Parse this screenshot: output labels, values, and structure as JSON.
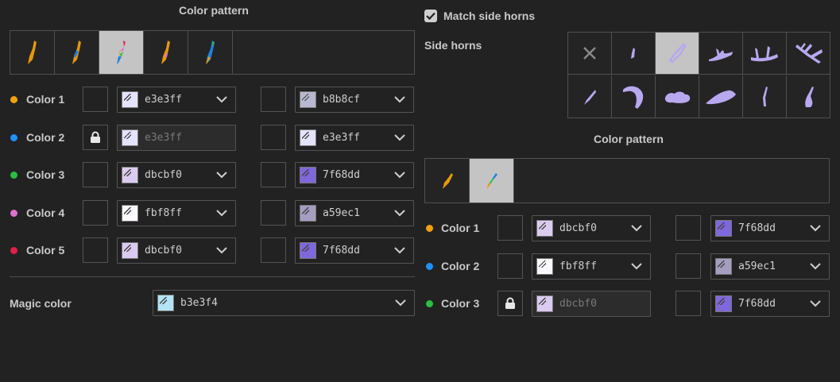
{
  "left": {
    "pattern_heading": "Color pattern",
    "pattern_count": 5,
    "selected_pattern": 2,
    "rows": [
      {
        "label": "Color 1",
        "dot": "#f0a010",
        "locked": false,
        "a_hex": "e3e3ff",
        "a_color": "#e3e3ff",
        "a_disabled": false,
        "b_hex": "b8b8cf",
        "b_color": "#b8b8cf"
      },
      {
        "label": "Color 2",
        "dot": "#1e90ff",
        "locked": true,
        "a_hex": "e3e3ff",
        "a_color": "#e3e3ff",
        "a_disabled": true,
        "b_hex": "e3e3ff",
        "b_color": "#e3e3ff"
      },
      {
        "label": "Color 3",
        "dot": "#28c040",
        "locked": false,
        "a_hex": "dbcbf0",
        "a_color": "#dbcbf0",
        "a_disabled": false,
        "b_hex": "7f68dd",
        "b_color": "#7f68dd"
      },
      {
        "label": "Color 4",
        "dot": "#e070d0",
        "locked": false,
        "a_hex": "fbf8ff",
        "a_color": "#fbf8ff",
        "a_disabled": false,
        "b_hex": "a59ec1",
        "b_color": "#a59ec1"
      },
      {
        "label": "Color 5",
        "dot": "#e0204a",
        "locked": false,
        "a_hex": "dbcbf0",
        "a_color": "#dbcbf0",
        "a_disabled": false,
        "b_hex": "7f68dd",
        "b_color": "#7f68dd"
      }
    ],
    "magic_label": "Magic color",
    "magic_hex": "b3e3f4",
    "magic_color": "#b3e3f4"
  },
  "right": {
    "match_label": "Match side horns",
    "match_checked": true,
    "side_horns_heading": "Side horns",
    "horn_options": [
      "none",
      "small-spike",
      "curved",
      "branch-1",
      "branch-2",
      "branch-3",
      "thin-spike",
      "hook",
      "cloud",
      "wing",
      "narrow",
      "sickle"
    ],
    "selected_horn": 2,
    "pattern_heading": "Color pattern",
    "selected_pattern": 1,
    "rows": [
      {
        "label": "Color 1",
        "dot": "#f0a010",
        "locked": false,
        "a_hex": "dbcbf0",
        "a_color": "#dbcbf0",
        "a_disabled": false,
        "b_hex": "7f68dd",
        "b_color": "#7f68dd"
      },
      {
        "label": "Color 2",
        "dot": "#1e90ff",
        "locked": false,
        "a_hex": "fbf8ff",
        "a_color": "#fbf8ff",
        "a_disabled": false,
        "b_hex": "a59ec1",
        "b_color": "#a59ec1"
      },
      {
        "label": "Color 3",
        "dot": "#28c040",
        "locked": true,
        "a_hex": "dbcbf0",
        "a_color": "#dbcbf0",
        "a_disabled": true,
        "b_hex": "7f68dd",
        "b_color": "#7f68dd"
      }
    ]
  },
  "icons": {
    "lock": "lock-icon",
    "chevron": "chevron-down-icon",
    "close": "x-icon",
    "check": "check-icon"
  },
  "colors": {
    "bg": "#222222",
    "border": "#505050",
    "selected": "#c4c4c4",
    "horn": "#b8a8f0"
  }
}
